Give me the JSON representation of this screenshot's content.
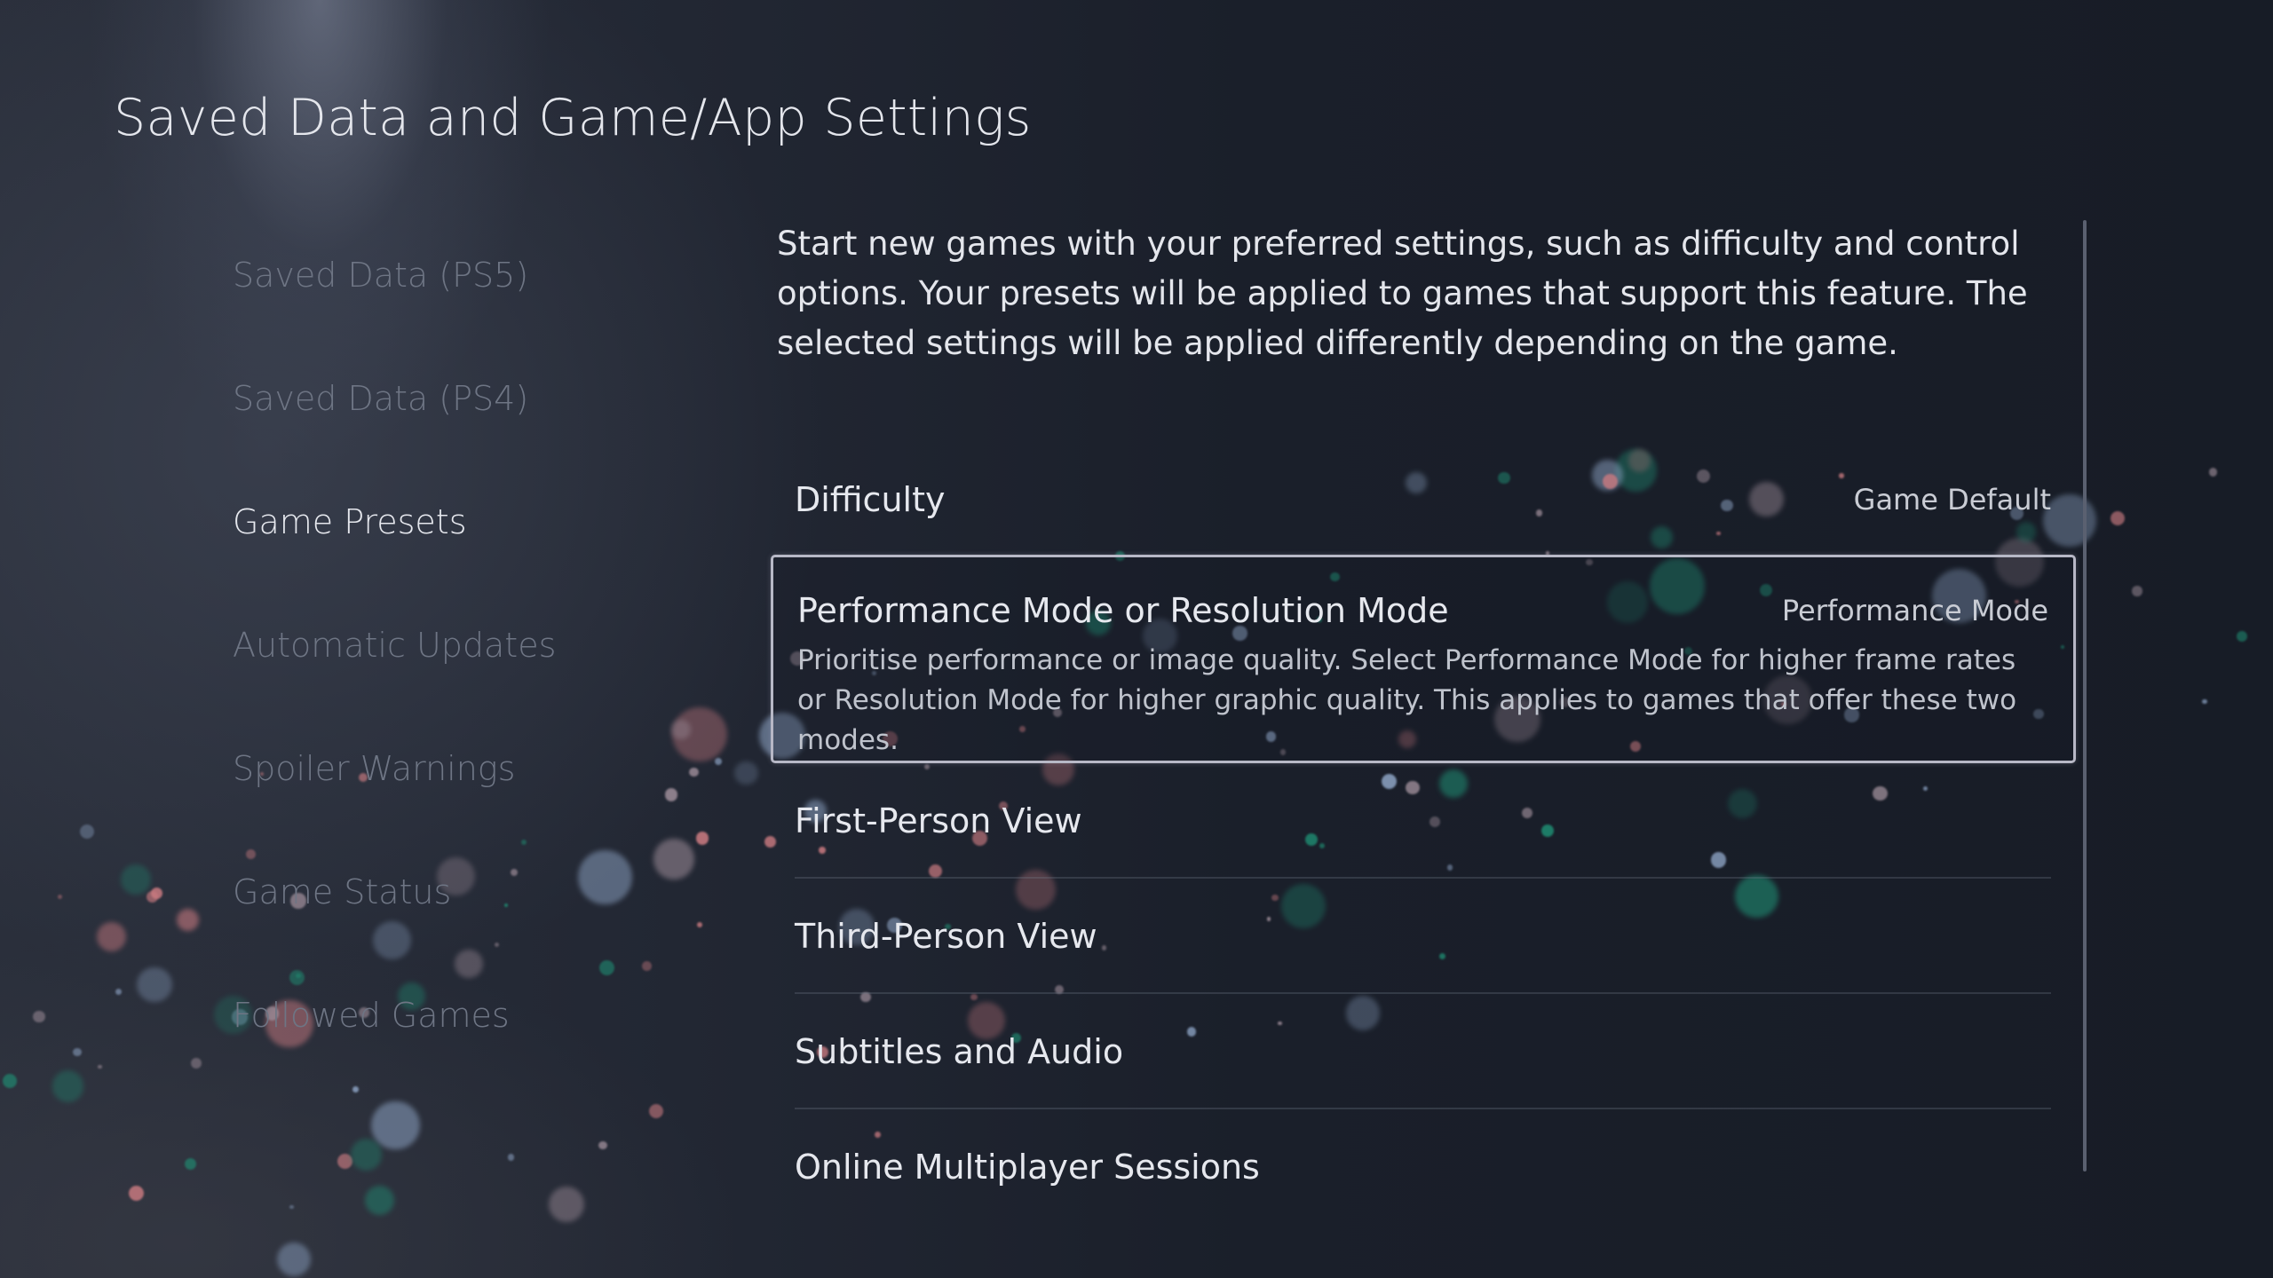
{
  "header": {
    "title": "Saved Data and Game/App Settings"
  },
  "sidebar": {
    "items": [
      {
        "label": "Saved Data (PS5)",
        "active": false
      },
      {
        "label": "Saved Data (PS4)",
        "active": false
      },
      {
        "label": "Game Presets",
        "active": true
      },
      {
        "label": "Automatic Updates",
        "active": false
      },
      {
        "label": "Spoiler Warnings",
        "active": false
      },
      {
        "label": "Game Status",
        "active": false
      },
      {
        "label": "Followed Games",
        "active": false
      }
    ]
  },
  "main": {
    "description": "Start new games with your preferred settings, such as difficulty and control options. Your presets will be applied to games that support this feature. The selected settings will be applied differently depending on the game.",
    "settings": [
      {
        "label": "Difficulty",
        "value": "Game Default"
      },
      {
        "label": "Performance Mode or Resolution Mode",
        "value": "Performance Mode",
        "focused": true,
        "hint": "Prioritise performance or image quality. Select Performance Mode for higher frame rates or Resolution Mode for higher graphic quality. This applies to games that offer these two modes."
      },
      {
        "label": "First-Person View",
        "value": ""
      },
      {
        "label": "Third-Person View",
        "value": ""
      },
      {
        "label": "Subtitles and Audio",
        "value": ""
      },
      {
        "label": "Online Multiplayer Sessions",
        "value": ""
      }
    ]
  },
  "colors": {
    "background": "#1b202b",
    "text_primary": "#e6e8ee",
    "text_inactive": "#6e7584",
    "focus_border": "#b7b8c6",
    "particle_teal": "#1f8f74",
    "particle_pink": "#c97a80",
    "particle_blue": "#8aa0c0"
  }
}
